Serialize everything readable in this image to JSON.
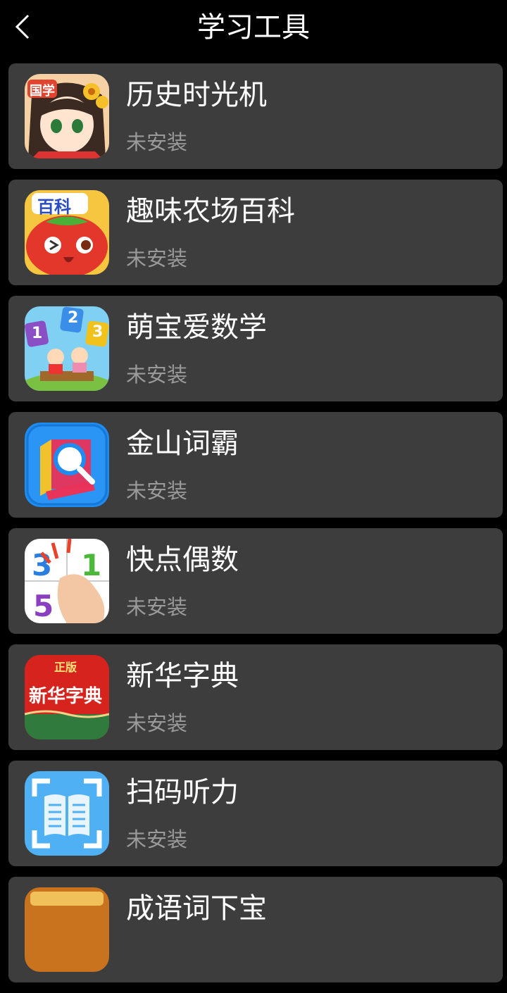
{
  "header": {
    "title": "学习工具",
    "back_icon": "chevron-left-icon"
  },
  "apps": [
    {
      "name": "历史时光机",
      "status": "未安装",
      "icon": "history-girl-app-icon",
      "badge": "国学"
    },
    {
      "name": "趣味农场百科",
      "status": "未安装",
      "icon": "tomato-app-icon",
      "badge": "百科"
    },
    {
      "name": "萌宝爱数学",
      "status": "未安装",
      "icon": "math-kids-app-icon",
      "digits": [
        "1",
        "2",
        "3"
      ]
    },
    {
      "name": "金山词霸",
      "status": "未安装",
      "icon": "magnifier-book-app-icon"
    },
    {
      "name": "快点偶数",
      "status": "未安装",
      "icon": "numbers-hand-app-icon"
    },
    {
      "name": "新华字典",
      "status": "未安装",
      "icon": "xinhua-dictionary-app-icon",
      "badge_top": "正版",
      "badge_main": "新华字典"
    },
    {
      "name": "扫码听力",
      "status": "未安装",
      "icon": "scan-book-app-icon"
    },
    {
      "name": "成语词下宝",
      "status": "",
      "icon": "partial-app-icon"
    }
  ],
  "colors": {
    "background": "#000000",
    "card": "#3d3d3d",
    "title_text": "#ffffff",
    "status_text": "#9a9a9a"
  }
}
